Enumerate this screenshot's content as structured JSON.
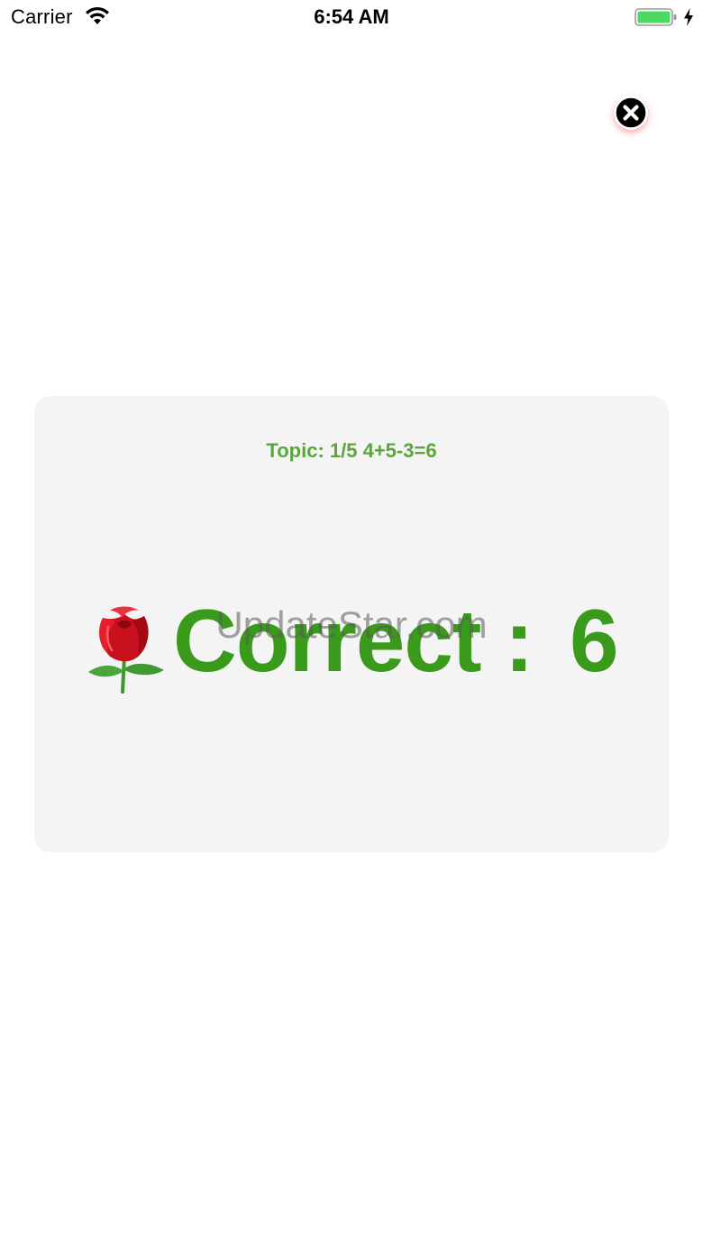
{
  "status_bar": {
    "carrier": "Carrier",
    "time": "6:54 AM",
    "battery_color": "#4cd964",
    "icons": [
      "wifi-icon",
      "battery-icon",
      "charging-bolt-icon"
    ]
  },
  "close_button": {
    "icon": "close-icon",
    "color": "#000000",
    "shadow_color": "#e63c3c"
  },
  "card": {
    "topic": "Topic: 1/5 4+5-3=6",
    "result_icon": "rose-icon",
    "result_label": "Correct :",
    "result_value": "6",
    "accent_color": "#3a9a1c",
    "background": "#f4f4f4"
  },
  "watermark": "UpdateStar.com"
}
